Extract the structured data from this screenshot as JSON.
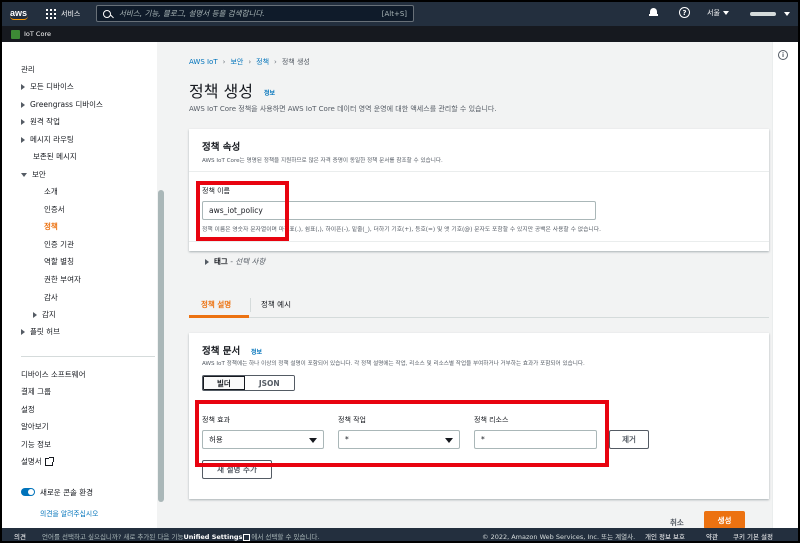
{
  "topnav": {
    "logo": "aws",
    "services": "서비스",
    "search_placeholder": "서비스, 기능, 블로그, 설명서 등을 검색합니다.",
    "search_shortcut": "[Alt+S]",
    "region": "서울",
    "help": "?"
  },
  "subnav": {
    "service": "IoT Core"
  },
  "sidebar": {
    "items": [
      {
        "label": "관리"
      },
      {
        "label": "모든 디바이스"
      },
      {
        "label": "Greengrass 디바이스"
      },
      {
        "label": "원격 작업"
      },
      {
        "label": "메시지 라우팅"
      },
      {
        "label": "보존된 메시지"
      },
      {
        "label": "보안"
      },
      {
        "label": "소개"
      },
      {
        "label": "인증서"
      },
      {
        "label": "정책"
      },
      {
        "label": "인증 기관"
      },
      {
        "label": "역할 별칭"
      },
      {
        "label": "권한 부여자"
      },
      {
        "label": "감사"
      },
      {
        "label": "감지"
      },
      {
        "label": "플릿 허브"
      }
    ],
    "bottom": [
      {
        "label": "디바이스 소프트웨어"
      },
      {
        "label": "결제 그룹"
      },
      {
        "label": "설정"
      },
      {
        "label": "알아보기"
      },
      {
        "label": "기능 정보"
      },
      {
        "label": "설명서"
      }
    ],
    "toggle_label": "새로운 콘솔 환경",
    "feedback_link": "의견을 알려주십시오"
  },
  "breadcrumb": {
    "items": [
      "AWS IoT",
      "보안",
      "정책"
    ],
    "current": "정책 생성"
  },
  "page": {
    "title": "정책 생성",
    "info": "정보",
    "description": "AWS IoT Core 정책을 사용하면 AWS IoT Core 데이터 영역 운영에 대한 액세스를 관리할 수 있습니다."
  },
  "properties": {
    "title": "정책 속성",
    "subtitle": "AWS IoT Core는 명명된 정책을 지원하므로 많은 자격 증명이 동일한 정책 문서를 참조할 수 있습니다.",
    "name_label": "정책 이름",
    "name_value": "aws_iot_policy",
    "name_hint": "정책 이름은 영숫자 문자열이며 마침표(.), 쉼표(,), 하이픈(-), 밑줄(_), 더하기 기호(+), 등호(=) 및 앳 기호(@) 문자도 포함할 수 있지만 공백은 사용할 수 없습니다.",
    "tags_label": "태그",
    "tags_optional": "- 선택 사항"
  },
  "tabs": [
    {
      "label": "정책 설명"
    },
    {
      "label": "정책 예시"
    }
  ],
  "document": {
    "title": "정책 문서",
    "info": "정보",
    "subtitle": "AWS IoT 정책에는 하나 이상의 정책 설명이 포함되어 있습니다. 각 정책 설명에는 작업, 리소스 및 리소스별 작업을 부여하거나 거부하는 효과가 포함되어 있습니다.",
    "mode_builder": "빌더",
    "mode_json": "JSON",
    "effect_label": "정책 효과",
    "effect_value": "허용",
    "action_label": "정책 작업",
    "action_value": "*",
    "resource_label": "정책 리소스",
    "resource_value": "*",
    "remove_button": "제거",
    "add_button": "새 설명 추가"
  },
  "actions": {
    "cancel": "취소",
    "create": "생성"
  },
  "footer": {
    "feedback": "의견",
    "lang_prefix": "언어를 선택하고 싶으십니까? 새로 추가된 다음 기능",
    "lang_bold": "Unified Settings",
    "lang_suffix": "에서 선택할 수 있습니다.",
    "copyright": "© 2022, Amazon Web Services, Inc. 또는 계열사.",
    "privacy": "개인 정보 보호",
    "terms": "약관",
    "cookies": "쿠키 기본 설정"
  },
  "colors": {
    "nav_bg": "#232f3e",
    "accent_orange": "#ec7211",
    "link_blue": "#0073bb",
    "highlight_red": "#e8030f"
  }
}
